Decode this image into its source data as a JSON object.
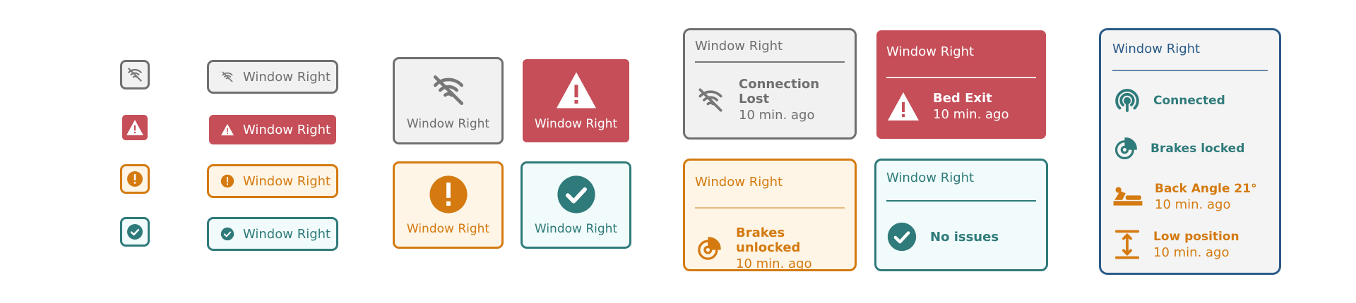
{
  "label": "Window Right",
  "colors": {
    "gray": "#8a8a8a",
    "red": "#c54e58",
    "orange": "#d47a10",
    "teal": "#2f7a7a",
    "blue": "#2a5a88"
  },
  "icons": [
    "signal-off-icon",
    "warning-triangle-icon",
    "exclamation-circle-icon",
    "check-circle-icon",
    "brake-icon",
    "connected-icon",
    "bed-angle-icon",
    "low-position-icon"
  ],
  "cards": {
    "gray": {
      "title": "Connection Lost",
      "time": "10 min. ago"
    },
    "red": {
      "title": "Bed Exit",
      "time": "10 min. ago"
    },
    "orange": {
      "title": "Brakes unlocked",
      "time": "10 min. ago"
    },
    "teal": {
      "title": "No issues"
    }
  },
  "panel": {
    "items": [
      {
        "title": "Connected"
      },
      {
        "title": "Brakes locked"
      },
      {
        "title": "Back Angle 21°",
        "time": "10 min. ago"
      },
      {
        "title": "Low position",
        "time": "10 min. ago"
      }
    ]
  }
}
